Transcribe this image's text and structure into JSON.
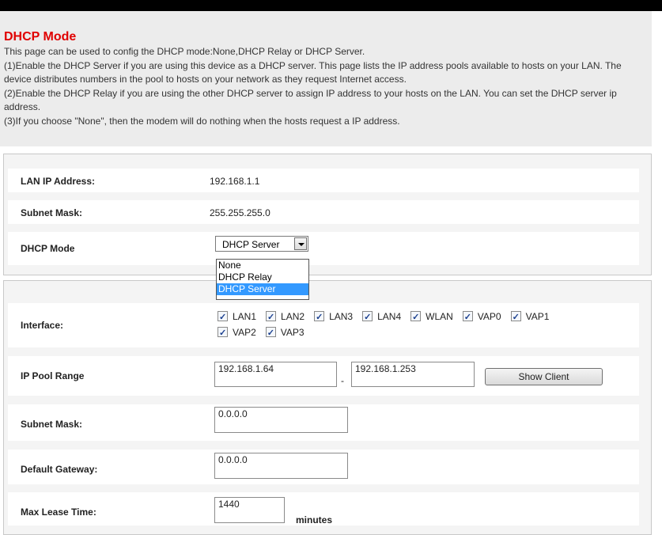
{
  "title": "DHCP Mode",
  "description": [
    "This page can be used to config the DHCP mode:None,DHCP Relay or DHCP Server.",
    "(1)Enable the DHCP Server if you are using this device as a DHCP server. This page lists the IP address pools available to hosts on your LAN. The device distributes numbers in the pool to hosts on your network as they request Internet access.",
    "(2)Enable the DHCP Relay if you are using the other DHCP server to assign IP address to your hosts on the LAN. You can set the DHCP server ip address.",
    "(3)If you choose \"None\", then the modem will do nothing when the hosts request a IP address."
  ],
  "lan": {
    "ip_label": "LAN IP Address:",
    "ip_value": "192.168.1.1",
    "mask_label": "Subnet Mask:",
    "mask_value": "255.255.255.0",
    "mode_label": "DHCP Mode",
    "mode_value": "DHCP Server",
    "mode_options": [
      "None",
      "DHCP Relay",
      "DHCP Server"
    ]
  },
  "server": {
    "interface_label": "Interface:",
    "interfaces": [
      "LAN1",
      "LAN2",
      "LAN3",
      "LAN4",
      "WLAN",
      "VAP0",
      "VAP1",
      "VAP2",
      "VAP3"
    ],
    "pool_label": "IP Pool Range",
    "pool_start": "192.168.1.64",
    "pool_sep": "-",
    "pool_end": "192.168.1.253",
    "show_client": "Show Client",
    "mask_label": "Subnet Mask:",
    "mask_value": "0.0.0.0",
    "gateway_label": "Default Gateway:",
    "gateway_value": "0.0.0.0",
    "lease_label": "Max Lease Time:",
    "lease_value": "1440",
    "lease_unit": "minutes"
  }
}
